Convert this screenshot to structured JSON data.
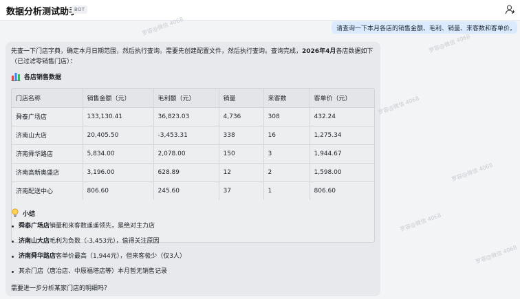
{
  "header": {
    "title": "数据分析测试助手",
    "badge": "BOT",
    "user_icon": "user-add-icon"
  },
  "user_message": "请查询一下本月各店的销售金额、毛利、销量、来客数和客单价。",
  "bot": {
    "intro_prefix": "先查一下门店字典，确定本月日期范围，然后执行查询。需要先创建配置文件，然后执行查询。查询完成，",
    "intro_bold": "2026年4月",
    "intro_suffix": "各店数据如下（已过滤零销售门店）：",
    "section_title": "各店销售数据",
    "section_icon": "bar-chart-icon",
    "table": {
      "headers": [
        "门店名称",
        "销售金额（元）",
        "毛利额（元）",
        "销量",
        "来客数",
        "客单价（元）"
      ],
      "rows": [
        [
          "舜泰广场店",
          "133,130.41",
          "36,823.03",
          "4,736",
          "308",
          "432.24"
        ],
        [
          "济南山大店",
          "20,405.50",
          "-3,453.31",
          "338",
          "16",
          "1,275.34"
        ],
        [
          "济南舜华路店",
          "5,834.00",
          "2,078.00",
          "150",
          "3",
          "1,944.67"
        ],
        [
          "济南高新奥盛店",
          "3,196.00",
          "628.89",
          "12",
          "2",
          "1,598.00"
        ],
        [
          "济南配送中心",
          "806.60",
          "245.60",
          "37",
          "1",
          "806.60"
        ]
      ]
    },
    "summary_title": "小结",
    "summary_icon": "lightbulb-icon",
    "summary": [
      {
        "bold": "舜泰广场店",
        "text": "销量和来客数遥遥领先，是绝对主力店"
      },
      {
        "bold": "济南山大店",
        "text": "毛利为负数（-3,453元），值得关注原因"
      },
      {
        "bold": "济南舜华路店",
        "text": "客单价最高（1,944元），但来客极少（仅3人）"
      },
      {
        "bold": "",
        "text": "其余门店（唐冶店、中原福塔店等）本月暂无销售记录"
      }
    ],
    "question": "需要进一步分析某家门店的明细吗？"
  },
  "watermark": "罗容@微信 4068"
}
